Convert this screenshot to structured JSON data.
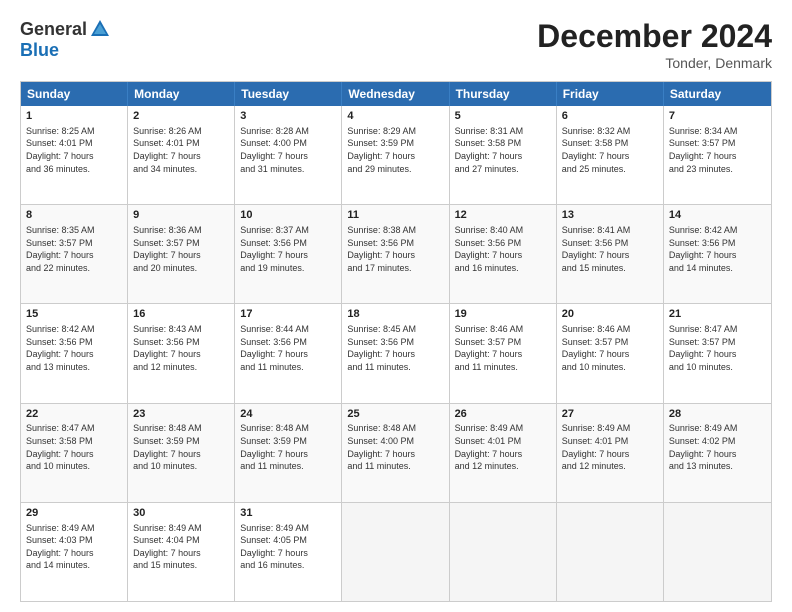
{
  "logo": {
    "general": "General",
    "blue": "Blue"
  },
  "title": "December 2024",
  "subtitle": "Tonder, Denmark",
  "days": [
    "Sunday",
    "Monday",
    "Tuesday",
    "Wednesday",
    "Thursday",
    "Friday",
    "Saturday"
  ],
  "weeks": [
    [
      {
        "day": "1",
        "info": "Sunrise: 8:25 AM\nSunset: 4:01 PM\nDaylight: 7 hours\nand 36 minutes."
      },
      {
        "day": "2",
        "info": "Sunrise: 8:26 AM\nSunset: 4:01 PM\nDaylight: 7 hours\nand 34 minutes."
      },
      {
        "day": "3",
        "info": "Sunrise: 8:28 AM\nSunset: 4:00 PM\nDaylight: 7 hours\nand 31 minutes."
      },
      {
        "day": "4",
        "info": "Sunrise: 8:29 AM\nSunset: 3:59 PM\nDaylight: 7 hours\nand 29 minutes."
      },
      {
        "day": "5",
        "info": "Sunrise: 8:31 AM\nSunset: 3:58 PM\nDaylight: 7 hours\nand 27 minutes."
      },
      {
        "day": "6",
        "info": "Sunrise: 8:32 AM\nSunset: 3:58 PM\nDaylight: 7 hours\nand 25 minutes."
      },
      {
        "day": "7",
        "info": "Sunrise: 8:34 AM\nSunset: 3:57 PM\nDaylight: 7 hours\nand 23 minutes."
      }
    ],
    [
      {
        "day": "8",
        "info": "Sunrise: 8:35 AM\nSunset: 3:57 PM\nDaylight: 7 hours\nand 22 minutes."
      },
      {
        "day": "9",
        "info": "Sunrise: 8:36 AM\nSunset: 3:57 PM\nDaylight: 7 hours\nand 20 minutes."
      },
      {
        "day": "10",
        "info": "Sunrise: 8:37 AM\nSunset: 3:56 PM\nDaylight: 7 hours\nand 19 minutes."
      },
      {
        "day": "11",
        "info": "Sunrise: 8:38 AM\nSunset: 3:56 PM\nDaylight: 7 hours\nand 17 minutes."
      },
      {
        "day": "12",
        "info": "Sunrise: 8:40 AM\nSunset: 3:56 PM\nDaylight: 7 hours\nand 16 minutes."
      },
      {
        "day": "13",
        "info": "Sunrise: 8:41 AM\nSunset: 3:56 PM\nDaylight: 7 hours\nand 15 minutes."
      },
      {
        "day": "14",
        "info": "Sunrise: 8:42 AM\nSunset: 3:56 PM\nDaylight: 7 hours\nand 14 minutes."
      }
    ],
    [
      {
        "day": "15",
        "info": "Sunrise: 8:42 AM\nSunset: 3:56 PM\nDaylight: 7 hours\nand 13 minutes."
      },
      {
        "day": "16",
        "info": "Sunrise: 8:43 AM\nSunset: 3:56 PM\nDaylight: 7 hours\nand 12 minutes."
      },
      {
        "day": "17",
        "info": "Sunrise: 8:44 AM\nSunset: 3:56 PM\nDaylight: 7 hours\nand 11 minutes."
      },
      {
        "day": "18",
        "info": "Sunrise: 8:45 AM\nSunset: 3:56 PM\nDaylight: 7 hours\nand 11 minutes."
      },
      {
        "day": "19",
        "info": "Sunrise: 8:46 AM\nSunset: 3:57 PM\nDaylight: 7 hours\nand 11 minutes."
      },
      {
        "day": "20",
        "info": "Sunrise: 8:46 AM\nSunset: 3:57 PM\nDaylight: 7 hours\nand 10 minutes."
      },
      {
        "day": "21",
        "info": "Sunrise: 8:47 AM\nSunset: 3:57 PM\nDaylight: 7 hours\nand 10 minutes."
      }
    ],
    [
      {
        "day": "22",
        "info": "Sunrise: 8:47 AM\nSunset: 3:58 PM\nDaylight: 7 hours\nand 10 minutes."
      },
      {
        "day": "23",
        "info": "Sunrise: 8:48 AM\nSunset: 3:59 PM\nDaylight: 7 hours\nand 10 minutes."
      },
      {
        "day": "24",
        "info": "Sunrise: 8:48 AM\nSunset: 3:59 PM\nDaylight: 7 hours\nand 11 minutes."
      },
      {
        "day": "25",
        "info": "Sunrise: 8:48 AM\nSunset: 4:00 PM\nDaylight: 7 hours\nand 11 minutes."
      },
      {
        "day": "26",
        "info": "Sunrise: 8:49 AM\nSunset: 4:01 PM\nDaylight: 7 hours\nand 12 minutes."
      },
      {
        "day": "27",
        "info": "Sunrise: 8:49 AM\nSunset: 4:01 PM\nDaylight: 7 hours\nand 12 minutes."
      },
      {
        "day": "28",
        "info": "Sunrise: 8:49 AM\nSunset: 4:02 PM\nDaylight: 7 hours\nand 13 minutes."
      }
    ],
    [
      {
        "day": "29",
        "info": "Sunrise: 8:49 AM\nSunset: 4:03 PM\nDaylight: 7 hours\nand 14 minutes."
      },
      {
        "day": "30",
        "info": "Sunrise: 8:49 AM\nSunset: 4:04 PM\nDaylight: 7 hours\nand 15 minutes."
      },
      {
        "day": "31",
        "info": "Sunrise: 8:49 AM\nSunset: 4:05 PM\nDaylight: 7 hours\nand 16 minutes."
      },
      null,
      null,
      null,
      null
    ]
  ]
}
